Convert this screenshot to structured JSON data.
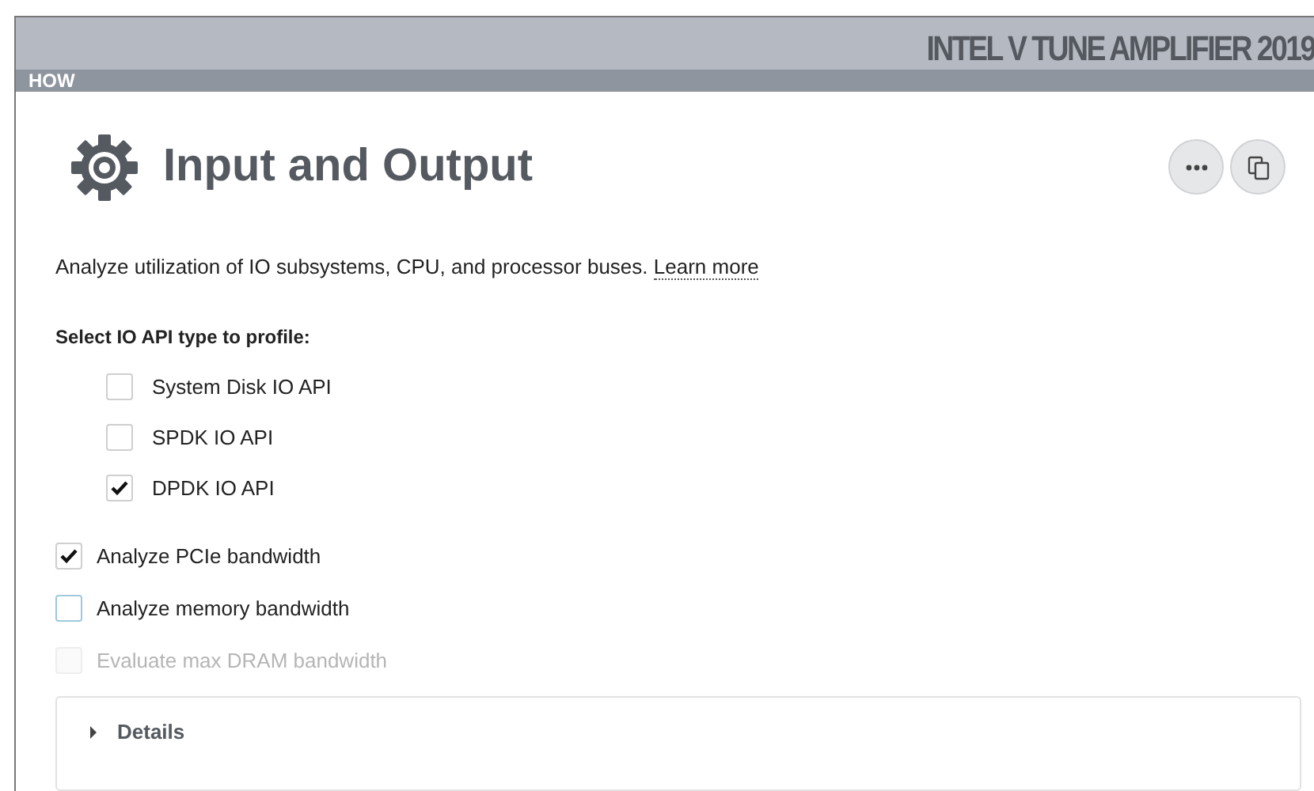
{
  "header": {
    "brand": "INTEL V TUNE AMPLIFIER 2019",
    "section": "HOW"
  },
  "analysis": {
    "title": "Input and Output",
    "description": "Analyze utilization of IO subsystems, CPU, and processor buses.",
    "learn_more": "Learn more"
  },
  "api_heading": "Select IO API type to profile:",
  "api_types": [
    {
      "label": "System Disk IO API",
      "checked": false
    },
    {
      "label": "SPDK IO API",
      "checked": false
    },
    {
      "label": "DPDK IO API",
      "checked": true
    }
  ],
  "options": [
    {
      "label": "Analyze PCIe bandwidth",
      "checked": true,
      "disabled": false
    },
    {
      "label": "Analyze memory bandwidth",
      "checked": false,
      "disabled": false
    },
    {
      "label": "Evaluate max DRAM bandwidth",
      "checked": false,
      "disabled": true
    }
  ],
  "details": {
    "label": "Details",
    "expanded": false
  }
}
